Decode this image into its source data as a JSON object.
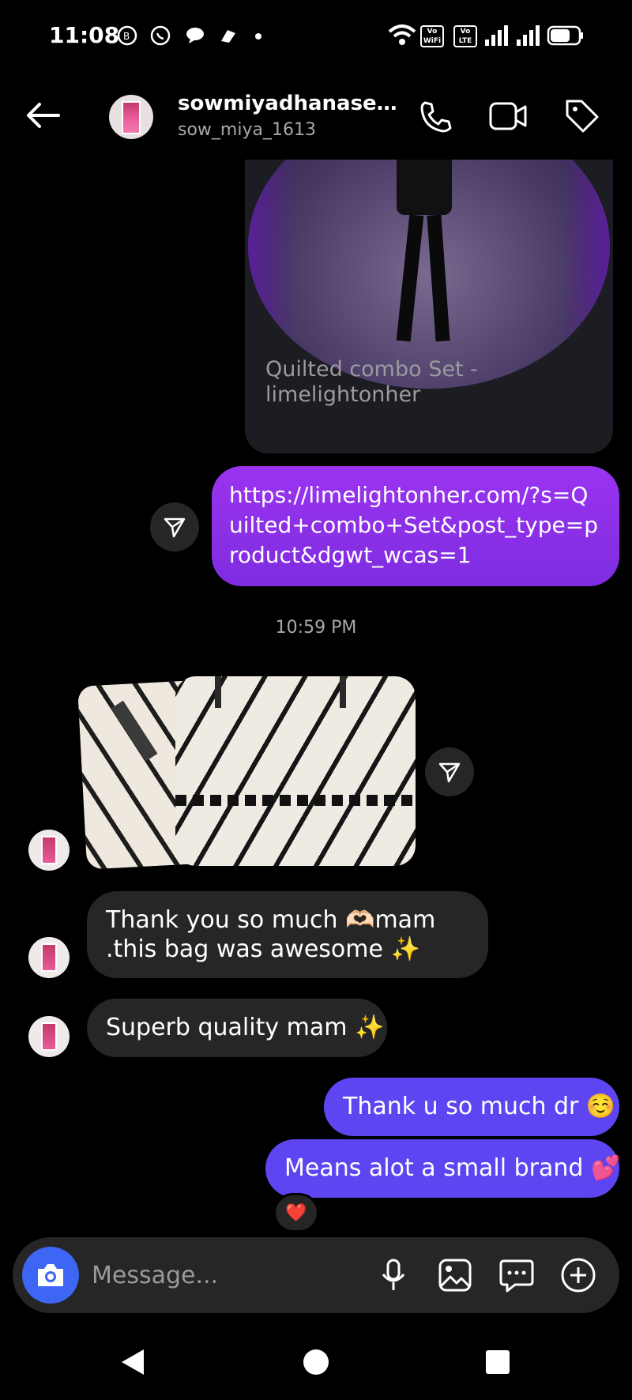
{
  "status_bar": {
    "time": "11:08",
    "icons": [
      "whatsapp-business-icon",
      "whatsapp-icon",
      "chat-icon",
      "app-icon",
      "dot-icon"
    ],
    "right_icons": [
      "wifi-icon",
      "vowifi-icon",
      "volte-icon",
      "signal-icon",
      "signal-icon",
      "battery-icon"
    ],
    "vowifi_label": "Vo WiFi",
    "volte_label": "Vo LTE"
  },
  "header": {
    "display_name": "sowmiyadhanase…",
    "username": "sow_miya_1613",
    "icons": [
      "back-arrow-icon",
      "phone-icon",
      "video-call-icon",
      "tag-icon"
    ]
  },
  "messages": {
    "shared_post_caption": "Quilted combo Set - limelightonher",
    "link_message": "https://limelightonher.com/?s=Quilted+combo+Set&post_type=product&dgwt_wcas=1",
    "timestamp": "10:59 PM",
    "received_1": "Thank you so much 🫶🏻mam .this bag was awesome ✨",
    "received_2": "Superb quality mam ✨",
    "sent_1": "Thank u so much dr ☺️",
    "sent_2": "Means alot a small brand 💕",
    "reaction": "❤️"
  },
  "composer": {
    "placeholder": "Message...",
    "icons": [
      "camera-icon",
      "microphone-icon",
      "gallery-icon",
      "sticker-icon",
      "add-icon"
    ]
  },
  "nav": {
    "icons": [
      "nav-back-icon",
      "nav-home-icon",
      "nav-recents-icon"
    ]
  },
  "colors": {
    "sent_link_bubble": "#8a2be2",
    "sent_bubble": "#5e45f2",
    "received_bubble": "#262626",
    "camera_button": "#3d66f5"
  }
}
